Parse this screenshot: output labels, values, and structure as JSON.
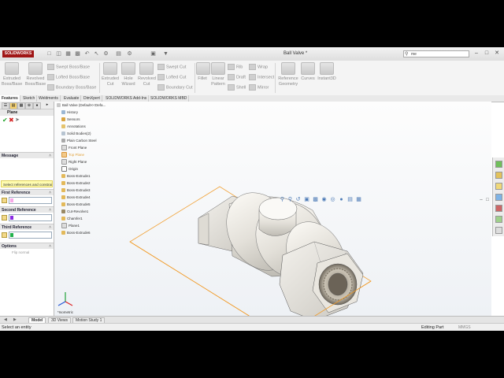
{
  "titlebar": {
    "brand": "SOLIDWORKS",
    "document_title": "Ball Valve *",
    "search_value": "me"
  },
  "ribbon": {
    "extruded_boss_base": "Extruded Boss/Base",
    "revolved_boss_base": "Revolved Boss/Base",
    "swept_boss_base": "Swept Boss/Base",
    "lofted_boss_base": "Lofted Boss/Base",
    "boundary_boss_base": "Boundary Boss/Base",
    "extruded_cut": "Extruded Cut",
    "hole_wizard": "Hole Wizard",
    "revolved_cut": "Revolved Cut",
    "swept_cut": "Swept Cut",
    "lofted_cut": "Lofted Cut",
    "boundary_cut": "Boundary Cut",
    "fillet": "Fillet",
    "linear_pattern": "Linear Pattern",
    "rib": "Rib",
    "draft": "Draft",
    "shell": "Shell",
    "wrap": "Wrap",
    "intersect": "Intersect",
    "mirror": "Mirror",
    "reference_geometry": "Reference Geometry",
    "curves": "Curves",
    "instant3d": "Instant3D"
  },
  "command_tabs": [
    "Features",
    "Sketch",
    "Weldments",
    "Evaluate",
    "DimXpert",
    "SOLIDWORKS Add-Ins",
    "SOLIDWORKS MBD"
  ],
  "property_manager": {
    "title": "Plane",
    "message_header": "Message",
    "message_text": "Select references and constraints",
    "first_reference": "First Reference",
    "second_reference": "Second Reference",
    "third_reference": "Third Reference",
    "options": "Options",
    "flip_normal": "Flip normal",
    "first_color": "#f7a8e8",
    "second_color": "#8a2be2",
    "third_color": "#22b14c"
  },
  "feature_tree": {
    "root": "Ball Valve  (Default<<Defa...",
    "items": [
      "History",
      "Sensors",
      "Annotations",
      "Solid Bodies(2)",
      "Plain Carbon Steel",
      "Front Plane",
      "Top Plane",
      "Right Plane",
      "Origin",
      "Boss-Extrude1",
      "Boss-Extrude2",
      "Boss-Extrude3",
      "Boss-Extrude4",
      "Boss-Extrude5",
      "Cut-Revolve1",
      "Chamfer1",
      "Plane1",
      "Boss-Extrude6"
    ]
  },
  "viewport": {
    "view_label": "*Isometric"
  },
  "bottom_tabs": [
    "Model",
    "3D Views",
    "Motion Study 1"
  ],
  "status": {
    "left": "Select an entity",
    "editing": "Editing Part",
    "units": "MMGS"
  }
}
